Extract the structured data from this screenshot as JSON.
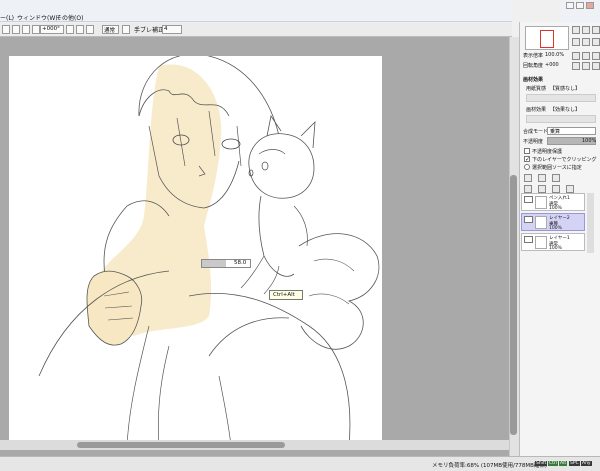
{
  "menu": {
    "items": [
      "ー(L)",
      "ウィンドウ(W)",
      "その他(O)"
    ]
  },
  "toolbar": {
    "rotation": "+000°",
    "mode_label": "通常",
    "stabilizer_label": "手ブレ補正",
    "stabilizer_value": "4"
  },
  "navigator": {
    "zoom_label": "表示倍率",
    "zoom_value": "100.0%",
    "angle_label": "回転角度",
    "angle_value": "+000"
  },
  "texture": {
    "header": "画材効果",
    "paper_label": "用紙質感",
    "paper_value": "【質感なし】",
    "effect_label": "画材効果",
    "effect_value": "【効果なし】"
  },
  "layer_props": {
    "blend_label": "合成モード",
    "blend_value": "乗算",
    "opacity_label": "不透明度",
    "opacity_value": "100%",
    "protect_label": "不透明度保護",
    "clip_label": "下のレイヤーでクリッピング",
    "select_src_label": "選択範囲ソースに指定"
  },
  "layers": [
    {
      "name": "ペン入れ1",
      "mode": "通常",
      "opacity": "100%"
    },
    {
      "name": "レイヤー2",
      "mode": "乗算",
      "opacity": "100%"
    },
    {
      "name": "レイヤー1",
      "mode": "通常",
      "opacity": "100%"
    }
  ],
  "canvas": {
    "brush_size_value": "58.0",
    "tooltip": "Ctrl+Alt"
  },
  "status": {
    "memory": "メモリ負荷率:68% (107MB使用/778MB確保)",
    "keys": [
      "Shift",
      "Ctrl",
      "Alt",
      "SPC",
      "Any"
    ]
  }
}
